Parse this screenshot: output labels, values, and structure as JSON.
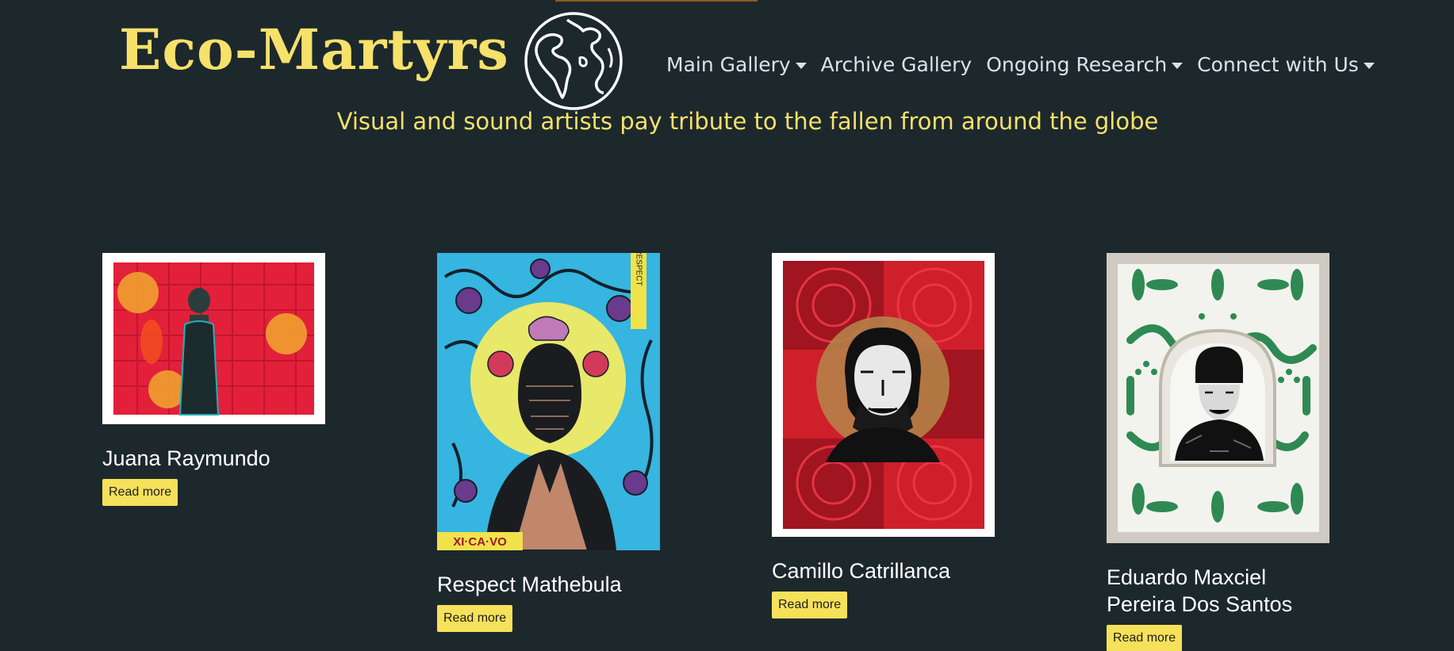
{
  "site": {
    "title": "Eco-Martyrs",
    "tagline": "Visual and sound artists pay tribute to the fallen from around the globe",
    "logo_icon": "globe-icon"
  },
  "nav": {
    "items": [
      {
        "label": "Main Gallery",
        "dropdown": true
      },
      {
        "label": "Archive Gallery",
        "dropdown": false
      },
      {
        "label": "Ongoing Research",
        "dropdown": true
      },
      {
        "label": "Connect with Us",
        "dropdown": true
      }
    ]
  },
  "gallery": {
    "cards": [
      {
        "name": "Juana Raymundo",
        "button": "Read more"
      },
      {
        "name": "Respect Mathebula",
        "button": "Read more",
        "artwork_text_top": "RESPECT",
        "artwork_text_bottom": "XI·CA·VO"
      },
      {
        "name": "Camillo Catrillanca",
        "button": "Read more"
      },
      {
        "name": "Eduardo Maxciel Pereira Dos Santos",
        "button": "Read more"
      }
    ]
  },
  "colors": {
    "background": "#1d282d",
    "accent": "#f6e16a",
    "nav_text": "#d8e4ec",
    "button_bg": "#f6e15a"
  }
}
